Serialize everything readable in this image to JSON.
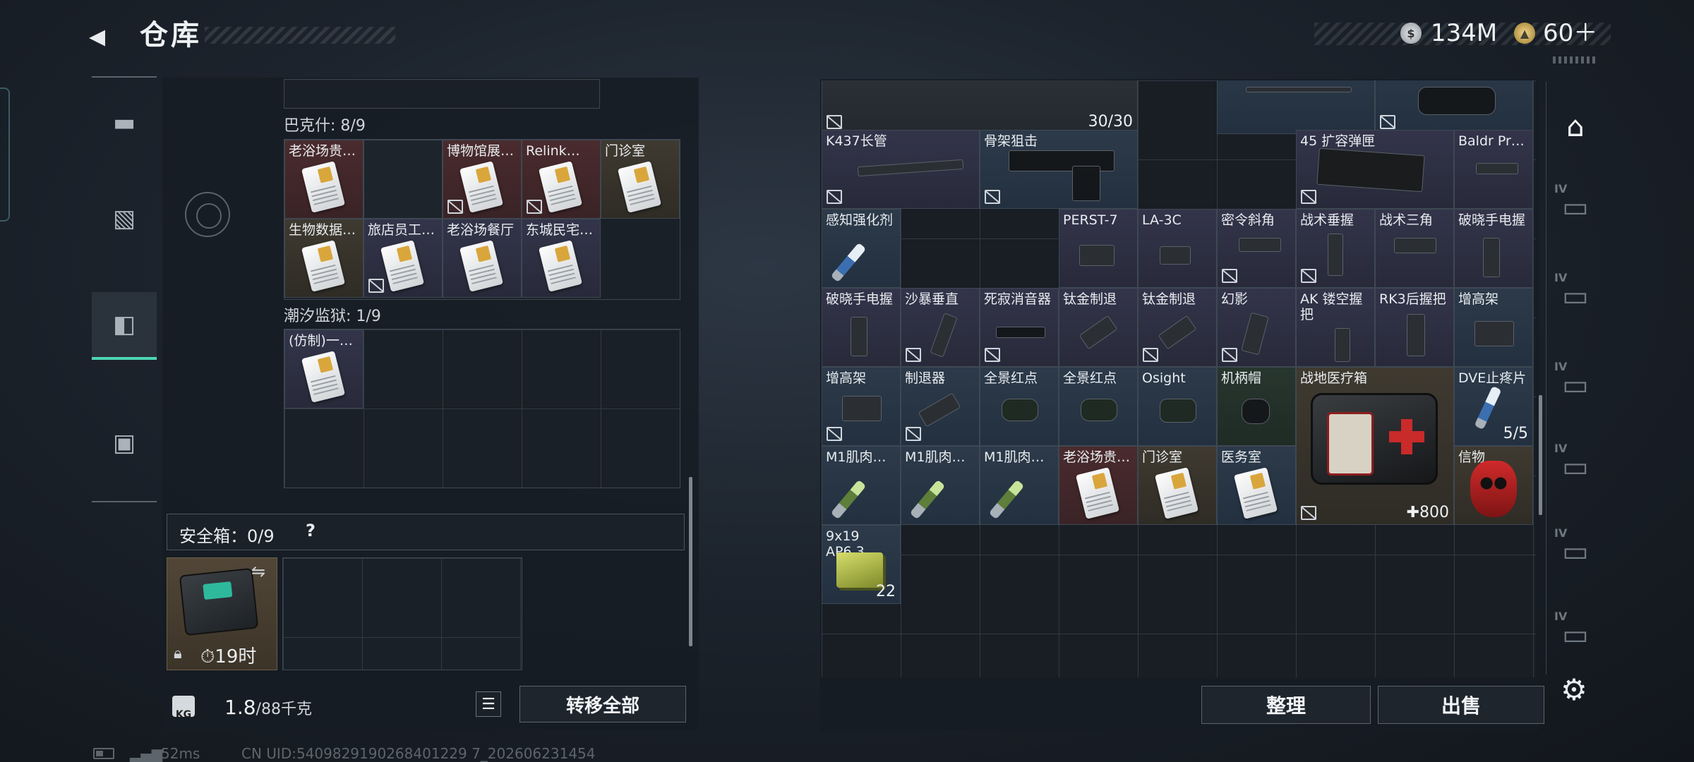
{
  "header": {
    "title": "仓库",
    "currency": [
      {
        "icon": "silver-coin-icon",
        "value": "134M"
      },
      {
        "icon": "gold-coin-icon",
        "value": "60＋"
      }
    ]
  },
  "left_tabs": [
    {
      "icon": "pistol-icon"
    },
    {
      "icon": "backpack-icon"
    },
    {
      "icon": "vest-icon",
      "active": true
    },
    {
      "icon": "case-icon"
    }
  ],
  "stash_left": {
    "sections": [
      {
        "label": "巴克什: 8/9",
        "items": [
          "老浴场贵…",
          "博物馆展…",
          "Relink…",
          "门诊室",
          "生物数据…",
          "旅店员工…",
          "老浴场餐厅",
          "东城民宅…"
        ]
      },
      {
        "label": "潮汐监狱: 1/9",
        "items": [
          "(仿制)一…"
        ]
      }
    ],
    "safe_box": {
      "label": "安全箱：0/9",
      "help": "?",
      "time": "19时"
    },
    "weight": {
      "current": "1.8",
      "max": "/88千克"
    },
    "transfer_label": "转移全部",
    "list_icon": "☰",
    "weight_icon_text": "KG"
  },
  "stash_right": {
    "top_count": "30/30",
    "items": {
      "k437": "K437长管",
      "skeleton": "骨架狙击",
      "ext45": "45 扩容弹匣",
      "baldr": "Baldr Pr…",
      "perception": "感知强化剂",
      "perst": "PERST-7",
      "la3c": "LA-3C",
      "secret_grip": "密令斜角",
      "tac_vgrip": "战术垂握",
      "tac_tri": "战术三角",
      "dawn_light1": "破晓手电握",
      "dawn_light2": "破晓手电握",
      "sand_grip": "沙暴垂直",
      "silent": "死寂消音器",
      "ti_brake1": "钛金制退",
      "ti_brake2": "钛金制退",
      "phantom": "幻影",
      "ak_grip": "AK 镂空握把",
      "rk3": "RK3后握把",
      "riser1": "增高架",
      "riser2": "增高架",
      "brake": "制退器",
      "holo1": "全景红点",
      "holo2": "全景红点",
      "osight": "Osight",
      "cap": "机柄帽",
      "medkit": "战地医疗箱",
      "dve": "DVE止疼片",
      "m1a": "M1肌肉…",
      "m1b": "M1肌肉…",
      "m1c": "M1肌肉…",
      "old_bath": "老浴场贵…",
      "clinic": "门诊室",
      "med_room": "医务室",
      "token": "信物",
      "ammo": "9x19 AP6.3"
    },
    "counts": {
      "dve": "5/5",
      "medkit": "✚800",
      "ammo": "22"
    },
    "sort_label": "整理",
    "sell_label": "出售"
  },
  "right_tabs": [
    {
      "icon": "all-items-icon"
    },
    {
      "level": "IV",
      "icon": "weapon-shelf-icon"
    },
    {
      "level": "IV",
      "icon": "attachment-shelf-icon"
    },
    {
      "level": "IV",
      "icon": "medical-shelf-icon"
    },
    {
      "level": "IV",
      "icon": "ammo-shelf-icon"
    },
    {
      "level": "IV",
      "icon": "add-shelf-icon"
    },
    {
      "level": "IV",
      "icon": "folder-shelf-icon"
    }
  ],
  "footer": {
    "ping": "52ms",
    "uid": "CN UID:5409829190268401229 7_202606231454"
  }
}
